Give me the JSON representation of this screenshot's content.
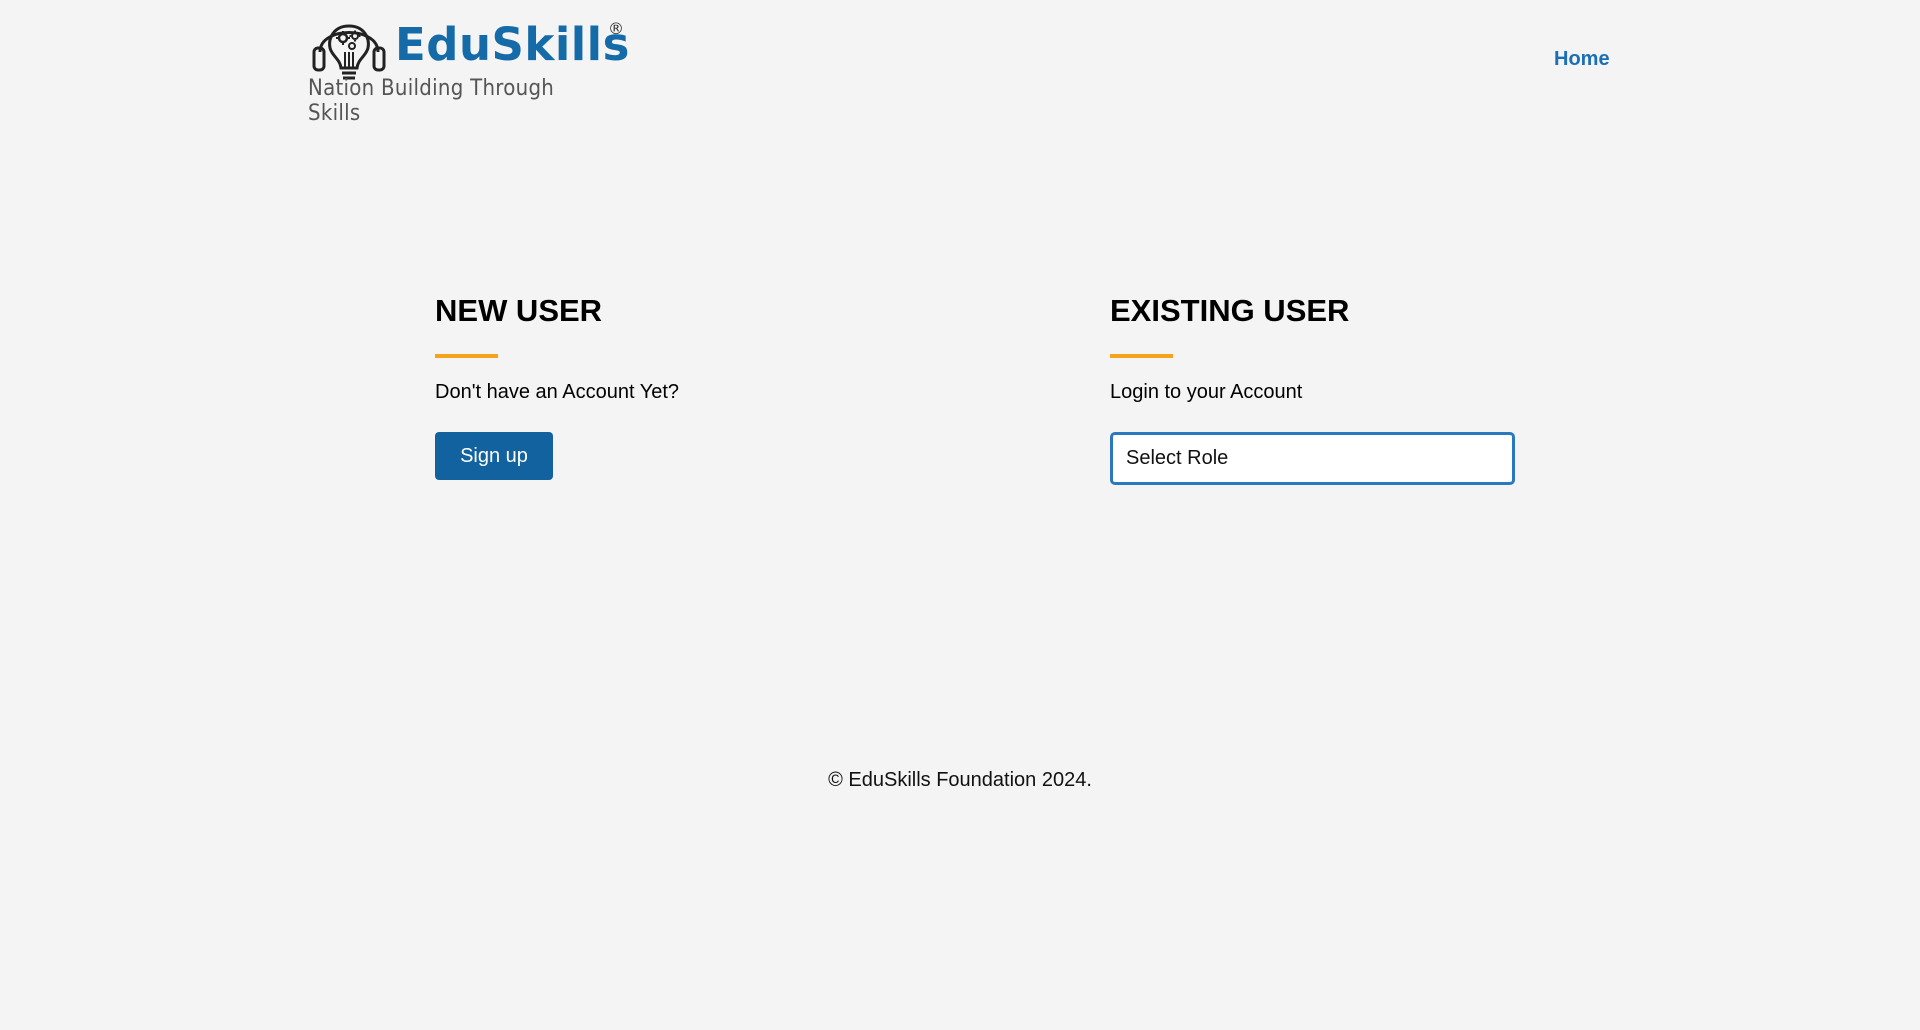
{
  "header": {
    "logo": {
      "brand": "EduSkills",
      "registered_mark": "®",
      "tagline": "Nation Building Through Skills",
      "icon": "lightbulb-headphones-icon",
      "brand_color": "#156aa8"
    },
    "nav": {
      "home_label": "Home"
    }
  },
  "new_user": {
    "title": "NEW USER",
    "subtitle": "Don't have an Account Yet?",
    "signup_label": "Sign up"
  },
  "existing_user": {
    "title": "EXISTING USER",
    "subtitle": "Login to your Account",
    "role_select_value": "Select Role"
  },
  "footer": {
    "copyright": "© EduSkills Foundation 2024."
  },
  "colors": {
    "background": "#f4f4f4",
    "primary": "#12629f",
    "link": "#1a6fb5",
    "accent": "#f5a31a",
    "select_border": "#2a78c0"
  }
}
